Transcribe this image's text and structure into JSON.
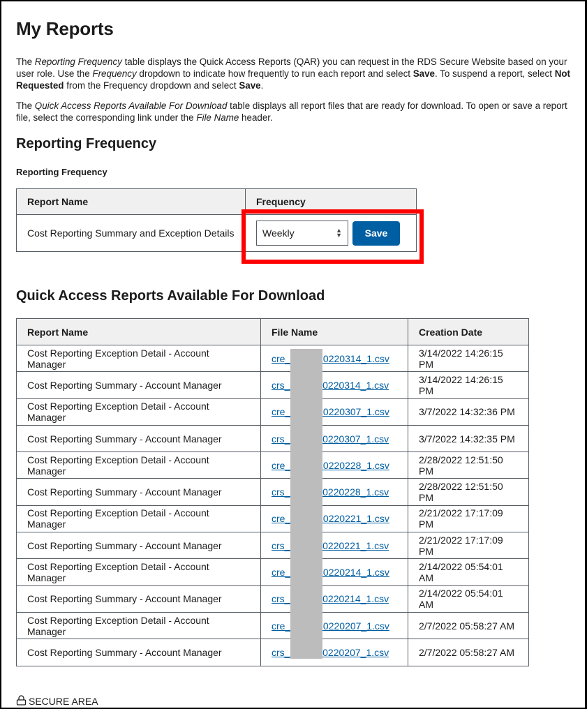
{
  "page": {
    "title": "My Reports",
    "intro_p1": {
      "t1": "The ",
      "i1": "Reporting Frequency",
      "t2": " table displays the Quick Access Reports (QAR) you can request in the RDS Secure Website based on your user role. Use the ",
      "i2": "Frequency",
      "t3": " dropdown to indicate how frequently to run each report and select ",
      "b1": "Save",
      "t4": ". To suspend a report, select ",
      "b2": "Not Requested",
      "t5": " from the Frequency dropdown and select ",
      "b3": "Save",
      "t6": "."
    },
    "intro_p2": {
      "t1": "The ",
      "i1": "Quick Access Reports Available For Download",
      "t2": " table displays all report files that are ready for download. To open or save a report file, select the corresponding link under the ",
      "i2": "File Name",
      "t3": " header."
    }
  },
  "reporting_frequency": {
    "heading": "Reporting Frequency",
    "caption": "Reporting Frequency",
    "columns": [
      "Report Name",
      "Frequency"
    ],
    "rows": [
      {
        "report_name": "Cost Reporting Summary and Exception Details",
        "frequency": "Weekly"
      }
    ],
    "save_label": "Save"
  },
  "downloads": {
    "heading": "Quick Access Reports Available For Download",
    "columns": [
      "Report Name",
      "File Name",
      "Creation Date"
    ],
    "rows": [
      {
        "report_name": "Cost Reporting Exception Detail - Account Manager",
        "file_prefix": "cre_",
        "file_suffix": "_20220314_1.csv",
        "created": "3/14/2022 14:26:15 PM"
      },
      {
        "report_name": "Cost Reporting Summary - Account Manager",
        "file_prefix": "crs_",
        "file_suffix": "_20220314_1.csv",
        "created": "3/14/2022 14:26:15 PM"
      },
      {
        "report_name": "Cost Reporting Exception Detail - Account Manager",
        "file_prefix": "cre_",
        "file_suffix": "_20220307_1.csv",
        "created": "3/7/2022 14:32:36 PM"
      },
      {
        "report_name": "Cost Reporting Summary - Account Manager",
        "file_prefix": "crs_",
        "file_suffix": "_20220307_1.csv",
        "created": "3/7/2022 14:32:35 PM"
      },
      {
        "report_name": "Cost Reporting Exception Detail - Account Manager",
        "file_prefix": "cre_",
        "file_suffix": "_20220228_1.csv",
        "created": "2/28/2022 12:51:50 PM"
      },
      {
        "report_name": "Cost Reporting Summary - Account Manager",
        "file_prefix": "crs_",
        "file_suffix": "_20220228_1.csv",
        "created": "2/28/2022 12:51:50 PM"
      },
      {
        "report_name": "Cost Reporting Exception Detail - Account Manager",
        "file_prefix": "cre_",
        "file_suffix": "_20220221_1.csv",
        "created": "2/21/2022 17:17:09 PM"
      },
      {
        "report_name": "Cost Reporting Summary - Account Manager",
        "file_prefix": "crs_",
        "file_suffix": "_20220221_1.csv",
        "created": "2/21/2022 17:17:09 PM"
      },
      {
        "report_name": "Cost Reporting Exception Detail - Account Manager",
        "file_prefix": "cre_",
        "file_suffix": "_20220214_1.csv",
        "created": "2/14/2022 05:54:01 AM"
      },
      {
        "report_name": "Cost Reporting Summary - Account Manager",
        "file_prefix": "crs_",
        "file_suffix": "_20220214_1.csv",
        "created": "2/14/2022 05:54:01 AM"
      },
      {
        "report_name": "Cost Reporting Exception Detail - Account Manager",
        "file_prefix": "cre_",
        "file_suffix": "_20220207_1.csv",
        "created": "2/7/2022 05:58:27 AM"
      },
      {
        "report_name": "Cost Reporting Summary - Account Manager",
        "file_prefix": "crs_",
        "file_suffix": "_20220207_1.csv",
        "created": "2/7/2022 05:58:27 AM"
      }
    ]
  },
  "footer": {
    "secure_label": "SECURE AREA",
    "icon": "lock-icon"
  },
  "colors": {
    "link": "#005ea2",
    "primary_button": "#005ea2",
    "highlight": "#ff0000",
    "table_header_bg": "#f0f0f0"
  }
}
